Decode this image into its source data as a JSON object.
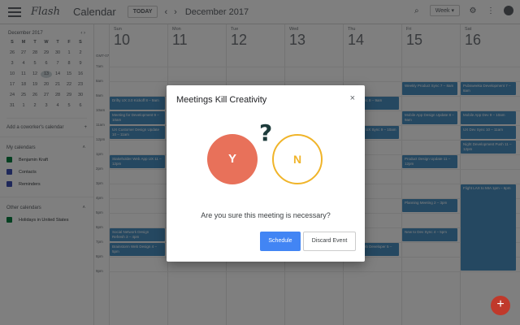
{
  "header": {
    "logo_text": "Flash",
    "app_title": "Calendar",
    "today_label": "TODAY",
    "prev_icon": "chevron-left-icon",
    "next_icon": "chevron-right-icon",
    "month_label": "December 2017",
    "view_label": "Week ▾",
    "search_icon": "search-icon",
    "settings_icon": "gear-icon",
    "apps_icon": "apps-icon",
    "account_icon": "avatar"
  },
  "mini_calendar": {
    "title": "December 2017",
    "prev": "‹",
    "next": "›",
    "weekdays": [
      "S",
      "M",
      "T",
      "W",
      "T",
      "F",
      "S"
    ],
    "days": [
      "26",
      "27",
      "28",
      "29",
      "30",
      "1",
      "2",
      "3",
      "4",
      "5",
      "6",
      "7",
      "8",
      "9",
      "10",
      "11",
      "12",
      "13",
      "14",
      "15",
      "16",
      "17",
      "18",
      "19",
      "20",
      "21",
      "22",
      "23",
      "24",
      "25",
      "26",
      "27",
      "28",
      "29",
      "30",
      "31",
      "1",
      "2",
      "3",
      "4",
      "5",
      "6"
    ],
    "selected_day": "13"
  },
  "sidebar": {
    "add_coworker": "Add a coworker's calendar",
    "add_icon": "+",
    "my_calendars_label": "My calendars",
    "my_calendars": [
      {
        "label": "Benjamin Kraft",
        "color": "#0b8043"
      },
      {
        "label": "Contacts",
        "color": "#3f51b5"
      },
      {
        "label": "Reminders",
        "color": "#3f51b5"
      }
    ],
    "other_calendars_label": "Other calendars",
    "other_calendars": [
      {
        "label": "Holidays in United States",
        "color": "#0b8043"
      }
    ]
  },
  "calendar": {
    "tz_label": "GMT-07",
    "days": [
      {
        "name": "Sun",
        "num": "10"
      },
      {
        "name": "Mon",
        "num": "11"
      },
      {
        "name": "Tue",
        "num": "12"
      },
      {
        "name": "Wed",
        "num": "13"
      },
      {
        "name": "Thu",
        "num": "14"
      },
      {
        "name": "Fri",
        "num": "15"
      },
      {
        "name": "Sat",
        "num": "16"
      }
    ],
    "times": [
      "7am",
      "8am",
      "9am",
      "10am",
      "11am",
      "12pm",
      "1pm",
      "2pm",
      "3pm",
      "4pm",
      "5pm",
      "6pm",
      "7pm",
      "8pm",
      "9pm"
    ],
    "events": [
      {
        "title": "Drifty UX 3.0 Kickoff 8 – 9am"
      },
      {
        "title": "Meeting for Development 9 – 10am"
      },
      {
        "title": "UX Customer Design Update 10 – 11am"
      },
      {
        "title": "Stakeholder Web App UX 11 – 12pm"
      },
      {
        "title": "Social Network Design Refresh 3 – 4pm"
      },
      {
        "title": "Brainstorm Web Design 4 – 5pm"
      },
      {
        "title": "Weekly Product Sync 7 – 8am"
      },
      {
        "title": "Mobile App Design Update 8 – 9am"
      },
      {
        "title": "Product Design Update 11 – 12pm"
      },
      {
        "title": "Planning Meeting 2 – 3pm"
      },
      {
        "title": "New to Dev Sync 4 – 5pm"
      },
      {
        "title": "Pubsweeka Development 7 – 8am"
      },
      {
        "title": "Mobile App Dev 9 – 10am"
      },
      {
        "title": "UX Dev Sync 10 – 11am"
      },
      {
        "title": "Night Development Push 11 – 12pm"
      },
      {
        "title": "Flight LAX to MIA 1pm – 6pm"
      },
      {
        "title": "Sync for Web Developer 5 – 6pm"
      },
      {
        "title": "Product Sync 8 – 9am"
      },
      {
        "title": "Design and UX Sync 9 – 10am"
      }
    ]
  },
  "modal": {
    "title": "Meetings Kill Creativity",
    "close_icon": "×",
    "question_mark": "?",
    "yes_label": "Y",
    "no_label": "N",
    "question": "Are you sure this meeting is necessary?",
    "schedule_label": "Schedule",
    "discard_label": "Discard Event"
  },
  "fab": {
    "label": "+",
    "color": "#c0392b"
  }
}
